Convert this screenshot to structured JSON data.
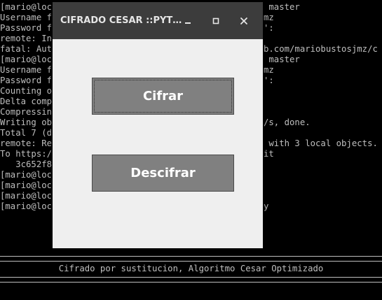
{
  "terminal": {
    "lines": [
      "[mario@loc",
      "Username f",
      "Password f",
      "remote: In",
      "fatal: Aut",
      "[mario@loc",
      "Username f",
      "Password f",
      "Counting o",
      "Delta comp",
      "Compressin",
      "Writing ob",
      "Total 7 (d",
      "remote: Re",
      "To https:/",
      "   3c652f8",
      "[mario@loc",
      "[mario@loc",
      "[mario@loc",
      "[mario@loc"
    ],
    "right_fragments": [
      {
        "row": 0,
        "text": " master"
      },
      {
        "row": 1,
        "text": "mz"
      },
      {
        "row": 2,
        "text": "':"
      },
      {
        "row": 4,
        "text": "b.com/mariobustosjmz/c"
      },
      {
        "row": 5,
        "text": " master"
      },
      {
        "row": 6,
        "text": "mz"
      },
      {
        "row": 7,
        "text": "':"
      },
      {
        "row": 11,
        "text": "/s, done."
      },
      {
        "row": 13,
        "text": " with 3 local objects."
      },
      {
        "row": 14,
        "text": "it"
      },
      {
        "row": 19,
        "text": "y"
      }
    ],
    "banner": "Cifrado por sustitucion, Algoritmo Cesar Optimizado"
  },
  "window": {
    "title": "CIFRADO CESAR ::PYTHON::",
    "minimize_icon": "minimize-icon",
    "maximize_icon": "maximize-icon",
    "close_icon": "close-icon"
  },
  "buttons": {
    "cifrar": "Cifrar",
    "descifrar": "Descifrar"
  },
  "colors": {
    "terminal_bg": "#000000",
    "terminal_text": "#bfbfbf",
    "titlebar_bg": "#3c3c3c",
    "window_bg": "#efefef",
    "button_bg": "#808080"
  }
}
